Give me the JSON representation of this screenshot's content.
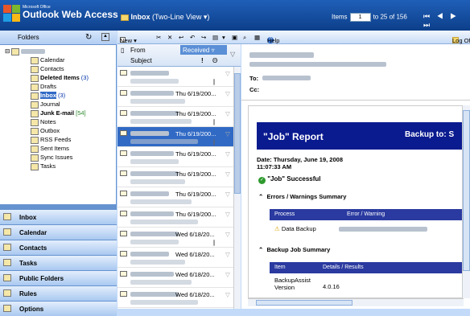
{
  "app": {
    "vendor": "Microsoft Office",
    "title": "Outlook Web Access",
    "folder": "Inbox",
    "view_mode": "(Two-Line View ▾)",
    "items_label": "Items",
    "page_value": "1",
    "items_range": "to 25 of 156",
    "pager": "⏮ ◀ ▶ ⏭"
  },
  "folders_pane": {
    "title": "Folders",
    "items": [
      {
        "label": "Calendar",
        "count": ""
      },
      {
        "label": "Contacts",
        "count": ""
      },
      {
        "label": "Deleted Items",
        "count": "(3)"
      },
      {
        "label": "Drafts",
        "count": ""
      },
      {
        "label": "Inbox",
        "count": "(3)"
      },
      {
        "label": "Journal",
        "count": ""
      },
      {
        "label": "Junk E-mail",
        "count": "[54]"
      },
      {
        "label": "Notes",
        "count": ""
      },
      {
        "label": "Outbox",
        "count": ""
      },
      {
        "label": "RSS Feeds",
        "count": ""
      },
      {
        "label": "Sent Items",
        "count": ""
      },
      {
        "label": "Sync Issues",
        "count": ""
      },
      {
        "label": "Tasks",
        "count": ""
      }
    ]
  },
  "nav_buttons": [
    "Inbox",
    "Calendar",
    "Contacts",
    "Tasks",
    "Public Folders",
    "Rules",
    "Options"
  ],
  "toolbar": {
    "new_label": "New ▾",
    "help_label": "Help",
    "logoff_label": "Log Off"
  },
  "list": {
    "col_from": "From",
    "col_received": "Received ▿",
    "col_subject": "Subject",
    "col_importance": "!",
    "col_attach": "Θ",
    "rows": [
      {
        "date": "",
        "selected": false,
        "clip": true
      },
      {
        "date": "Thu 6/19/200...",
        "selected": false,
        "clip": false
      },
      {
        "date": "Thu 6/19/200...",
        "selected": false,
        "clip": true
      },
      {
        "date": "Thu 6/19/200...",
        "selected": true,
        "clip": true
      },
      {
        "date": "Thu 6/19/200...",
        "selected": false,
        "clip": false
      },
      {
        "date": "Thu 6/19/200...",
        "selected": false,
        "clip": false
      },
      {
        "date": "Thu 6/19/200...",
        "selected": false,
        "clip": false
      },
      {
        "date": "Thu 6/19/200...",
        "selected": false,
        "clip": false
      },
      {
        "date": "Wed 6/18/20...",
        "selected": false,
        "clip": true
      },
      {
        "date": "Wed 6/18/20...",
        "selected": false,
        "clip": false
      },
      {
        "date": "Wed 6/18/20...",
        "selected": false,
        "clip": false
      },
      {
        "date": "Wed 6/18/20...",
        "selected": false,
        "clip": false
      }
    ]
  },
  "reading": {
    "to_label": "To:",
    "cc_label": "Cc:",
    "report_title": "\"Job\" Report",
    "backup_to": "Backup to: S",
    "date_line": "Date: Thursday, June 19, 2008",
    "time_line": "11:07:33 AM",
    "status": "\"Job\" Successful",
    "errors_section": "Errors / Warnings Summary",
    "errors_col1": "Process",
    "errors_col2": "Error / Warning",
    "errors_row1": "Data Backup",
    "backup_section": "Backup Job Summary",
    "backup_col1": "Item",
    "backup_col2": "Details / Results",
    "backup_row1_label": "BackupAssist Version",
    "backup_row1_value": "4.0.16"
  }
}
